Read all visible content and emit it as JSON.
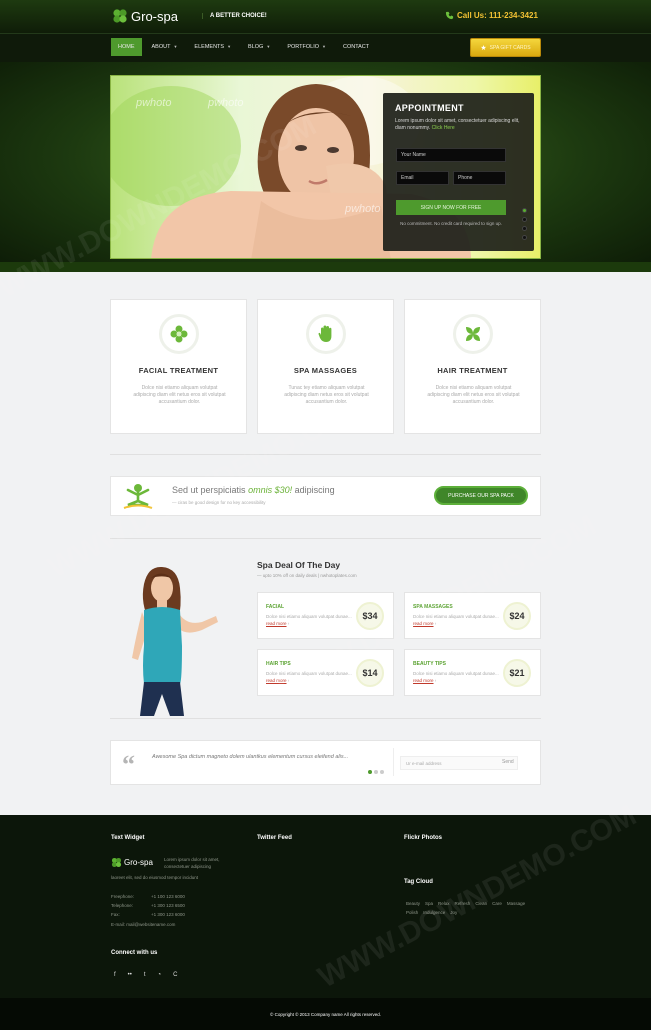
{
  "header": {
    "logo_text": "Gro-spa",
    "tagline": "A BETTER CHOICE!",
    "call_us": "Call Us: 111-234-3421"
  },
  "nav": {
    "items": [
      {
        "label": "HOME",
        "active": true
      },
      {
        "label": "ABOUT",
        "caret": true
      },
      {
        "label": "ELEMENTS",
        "caret": true
      },
      {
        "label": "BLOG",
        "caret": true
      },
      {
        "label": "PORTFOLIO",
        "caret": true
      },
      {
        "label": "CONTACT"
      }
    ],
    "cta_label": "SPA GIFT CARDS"
  },
  "hero": {
    "watermark": "pwhoto",
    "appointment": {
      "title": "APPOINTMENT",
      "text": "Lorem ipsum dolor sit amet, consectetuer adipiscing elit, diam nonummy.",
      "link": "Click Here",
      "name_placeholder": "Your Name",
      "email_placeholder": "Email",
      "phone_placeholder": "Phone",
      "button": "SIGN UP NOW FOR FREE",
      "note": "No commitment. No credit card required to sign up."
    }
  },
  "services": [
    {
      "title": "FACIAL TREATMENT",
      "text": "Dolce nisi etiamo aliquam volutpat adipiscing diam elit netus eros sit volutpat accusantium dolor.",
      "icon": "flower-icon"
    },
    {
      "title": "SPA MASSAGES",
      "text": "Tunac tey etiamo aliquam volutpat adipiscing diam netus eros sit volutpat accusantium dolor.",
      "icon": "hand-icon"
    },
    {
      "title": "HAIR TREATMENT",
      "text": "Dolce nisi etiamo aliquam volutpat adipiscing diam elit netus eros sit volutpat accusantium dolor.",
      "icon": "leaves-icon"
    }
  ],
  "promo": {
    "text_before": "Sed ut perspiciatis",
    "highlight": "omnis $30!",
    "text_after": "adipiscing",
    "sub": "— ciras be good design for no key accessibility",
    "button": "PURCHASE OUR SPA PACK"
  },
  "deal": {
    "title": "Spa Deal Of The Day",
    "subtitle": "— upto 10% off on daily deals | nwhotoplates.com",
    "items": [
      {
        "title": "FACIAL",
        "text": "Dolce nisi etiamo aliquam volutpat dunae...",
        "more": "read more",
        "price": "$34"
      },
      {
        "title": "SPA MASSAGES",
        "text": "Dolce nisi etiamo aliquam volutpat dunae...",
        "more": "read more",
        "price": "$24"
      },
      {
        "title": "HAIR TIPS",
        "text": "Dolce nisi etiamo aliquam volutpat dunae...",
        "more": "read more",
        "price": "$14"
      },
      {
        "title": "BEAUTY TIPS",
        "text": "Dolce nisi etiamo aliquam volutpat dunae...",
        "more": "read more",
        "price": "$21"
      }
    ]
  },
  "testimonial": {
    "text": "Awesome Spa dictum magneto dolem ulantkus elementum cursus eleifend alis...",
    "email_placeholder": "Ur e-mail address",
    "send": "Send"
  },
  "footer": {
    "text_widget_title": "Text Widget",
    "twitter_title": "Twitter Feed",
    "flickr_title": "Flickr Photos",
    "tag_cloud_title": "Tag Cloud",
    "logo_text": "Gro-spa",
    "about": "Lorem ipsum dolor sit amet, consectetuer adipiscing",
    "about2": "laoreet elit, sed do eiusmod tempor incidunt",
    "contacts": [
      {
        "label": "Freephone:",
        "value": "+1 100 123 6000"
      },
      {
        "label": "Telephone:",
        "value": "+1 300 123 6500"
      },
      {
        "label": "Fax:",
        "value": "+1 300 123 6000"
      }
    ],
    "email": "E-mail: mail@websitename.com",
    "connect_title": "Connect with us",
    "tags": [
      "Beauty",
      "Spa",
      "Relax",
      "Refresh",
      "Clean",
      "Care",
      "Massage",
      "Polish",
      "Indulgence",
      "Joy"
    ],
    "copyright": "© Copyright © 2013 Company name All rights reserved."
  },
  "watermark_text": "WWW.DOWNDEMO.COM",
  "colors": {
    "accent": "#4e9a2d",
    "gold": "#f2c233",
    "dark": "#0f1a0a"
  }
}
